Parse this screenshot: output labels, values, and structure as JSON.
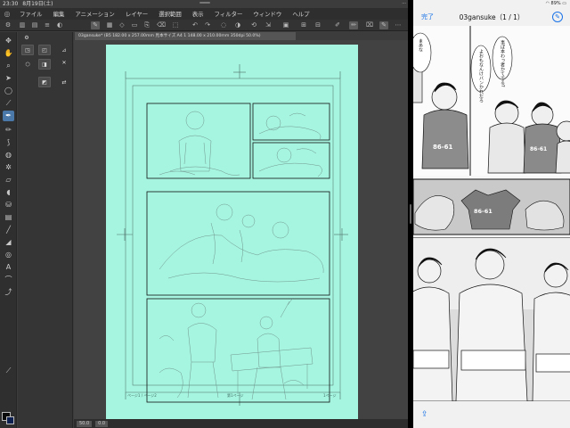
{
  "status_bar": {
    "time": "23:30",
    "date": "8月19日(土)",
    "right_text": "···"
  },
  "menu": {
    "items": [
      "ファイル",
      "編集",
      "アニメーション",
      "レイヤー",
      "選択範囲",
      "表示",
      "フィルター",
      "ウィンドウ",
      "ヘルプ"
    ]
  },
  "document": {
    "tab_label": "03gansuke* (B5 182.00 x 257.00mm 見本サイズ A4 1 148.00 x 210.00mm 350dpi 50.0%)"
  },
  "page": {
    "footer_left": "ページ1 / ページ2",
    "footer_center": "第1ページ",
    "footer_right": "1ページ"
  },
  "canvas_status": {
    "zoom": "50.0",
    "rotation": "0.0"
  },
  "viewer": {
    "done_label": "完了",
    "title": "03gansuke（1 / 1）",
    "battery": "89%",
    "jersey_text": "86-61",
    "speech_1": "事ぱ本わっ者かてでる?",
    "speech_2": "よおもなんけバンかれだろ",
    "speech_3": "まあな"
  },
  "colors": {
    "page_mint": "#a6f5e0",
    "app_bg": "#3c3c3c",
    "accent_blue": "#1a73e8"
  },
  "icons": {
    "paint_tools": [
      "move-icon",
      "hand-icon",
      "zoom-icon",
      "select-icon",
      "lasso-icon",
      "eyedropper-icon",
      "pen-icon",
      "pencil-icon",
      "brush-icon",
      "airbrush-icon",
      "decoration-icon",
      "eraser-icon",
      "blend-icon",
      "fill-icon",
      "gradient-icon",
      "figure-icon",
      "frame-icon",
      "ruler-icon",
      "text-icon",
      "balloon-icon",
      "correct-line-icon"
    ]
  }
}
